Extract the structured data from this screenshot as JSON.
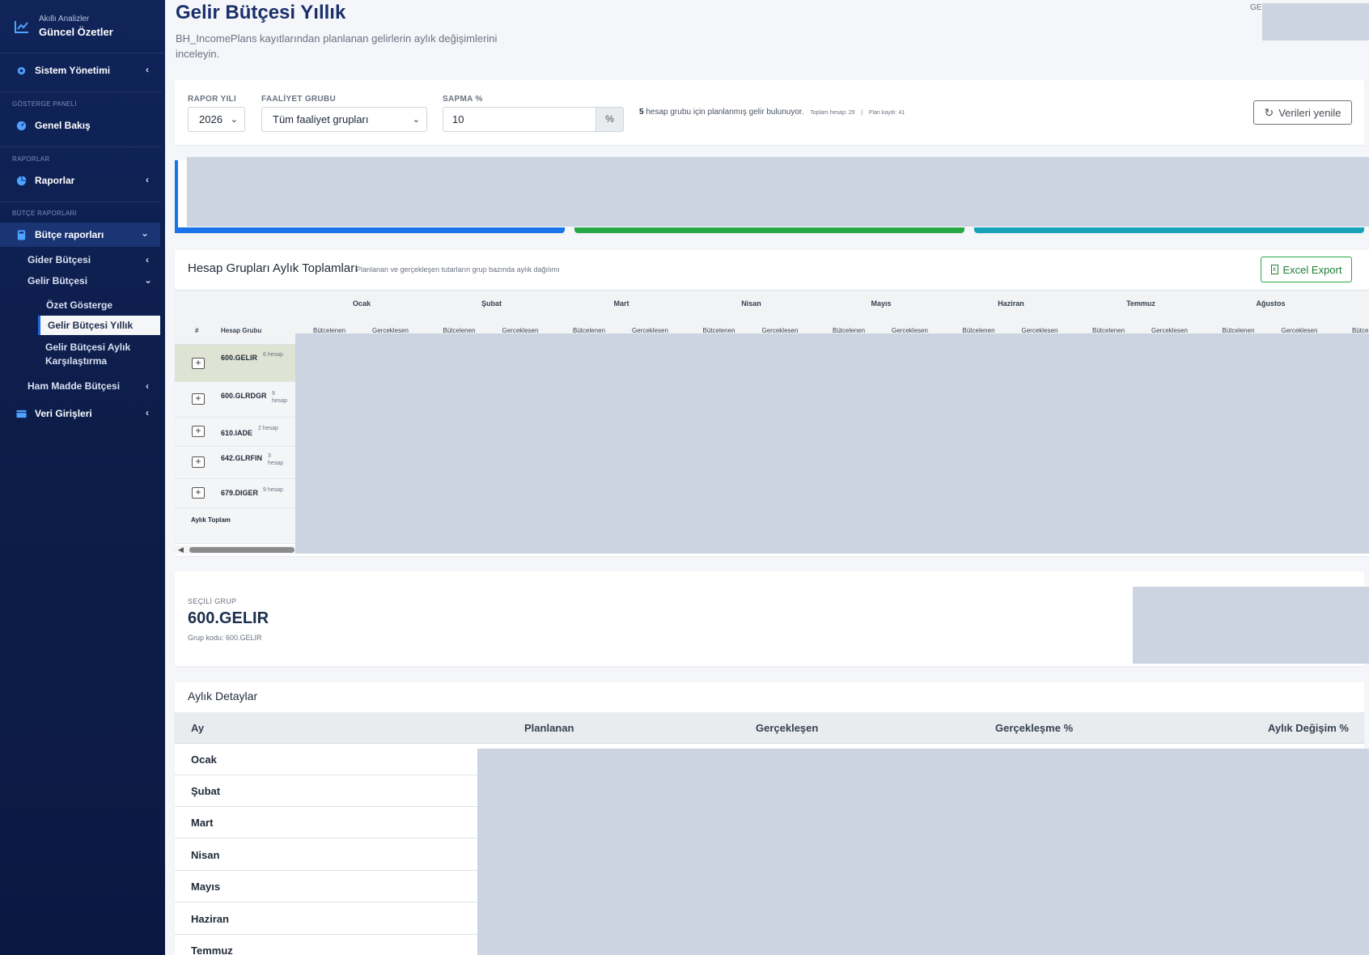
{
  "sidebar": {
    "brand_sub": "Akıllı Analizler",
    "brand_title": "Güncel Özetler",
    "system": "Sistem Yönetimi",
    "dash_head": "GÖSTERGE PANELİ",
    "overview": "Genel Bakış",
    "reports_head": "RAPORLAR",
    "reports": "Raporlar",
    "budget_head": "BÜTÇE RAPORLARI",
    "budget_reports": "Bütçe raporları",
    "expense_budget": "Gider Bütçesi",
    "income_budget": "Gelir Bütçesi",
    "summary": "Özet Gösterge",
    "income_yearly": "Gelir Bütçesi Yıllık",
    "income_monthly_1": "Gelir Bütçesi Aylık",
    "income_monthly_2": "Karşılaştırma",
    "raw_budget": "Ham Madde Bütçesi",
    "data_entry": "Veri Girişleri"
  },
  "header": {
    "title": "Gelir Bütçesi Yıllık",
    "description": "BH_IncomePlans kayıtlarından planlanan gelirlerin aylık değişimlerini inceleyin.",
    "top_right": "GEI"
  },
  "filters": {
    "year_label": "RAPOR YILI",
    "year_value": "2026",
    "group_label": "FAALİYET GRUBU",
    "group_value": "Tüm faaliyet grupları",
    "dev_label": "SAPMA %",
    "dev_value": "10",
    "dev_unit": "%",
    "info_count": "5",
    "info_text": "hesap grubu için planlanmış gelir bulunuyor.",
    "info_total": "Toplam hesap: 29",
    "info_sep": "|",
    "info_plan": "Plan kaydı: 41",
    "refresh": "Verileri yenile"
  },
  "kpi": {
    "colors": [
      "#1a73e8",
      "#28a745",
      "#17a2b8"
    ]
  },
  "groups": {
    "title": "Hesap Grupları Aylık Toplamları",
    "subtitle": "Planlanan ve gerçekleşen tutarların grup bazında aylık dağılımı",
    "export": "Excel Export",
    "col_no": "#",
    "col_group": "Hesap Grubu",
    "months": [
      "Ocak",
      "Şubat",
      "Mart",
      "Nisan",
      "Mayıs",
      "Haziran",
      "Temmuz",
      "Ağustos"
    ],
    "sub_planned": "Bütcelenen",
    "sub_actual": "Gerceklesen",
    "sub_cut": "Bütcele",
    "rows": [
      {
        "code": "600.GELIR",
        "count": "6 hesap"
      },
      {
        "code": "600.GLRDGR",
        "count_a": "9",
        "count_b": "hesap"
      },
      {
        "code": "610.IADE",
        "count": "2 hesap"
      },
      {
        "code": "642.GLRFIN",
        "count_a": "3",
        "count_b": "hesap"
      },
      {
        "code": "679.DIGER",
        "count": "9 hesap"
      }
    ],
    "total": "Aylık Toplam"
  },
  "selected": {
    "label": "SEÇİLİ GRUP",
    "name": "600.GELIR",
    "code_text": "Grup kodu: 600.GELIR"
  },
  "monthly": {
    "title": "Aylık Detaylar",
    "headers": [
      "Ay",
      "Planlanan",
      "Gerçekleşen",
      "Gerçekleşme %",
      "Aylık Değişim %"
    ],
    "months": [
      "Ocak",
      "Şubat",
      "Mart",
      "Nisan",
      "Mayıs",
      "Haziran",
      "Temmuz"
    ]
  }
}
